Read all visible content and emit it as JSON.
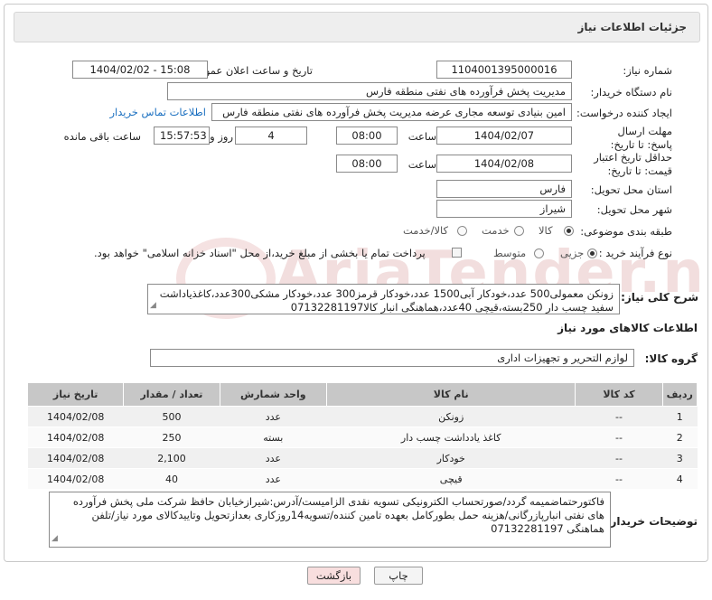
{
  "header": {
    "title": "جزئیات اطلاعات نیاز"
  },
  "fields": {
    "need_number_label": "شماره نیاز:",
    "need_number": "1104001395000016",
    "announce_label": "تاریخ و ساعت اعلان عمومی:",
    "announce_value": "1404/02/02 - 15:08",
    "buyer_org_label": "نام دستگاه خریدار:",
    "buyer_org": "مدیریت پخش فرآورده های نفتی منطقه فارس",
    "requester_label": "ایجاد کننده درخواست:",
    "requester": "امین بنیادی توسعه مجاری عرضه مدیریت پخش فرآورده های نفتی منطقه فارس",
    "contact_link": "اطلاعات تماس خریدار",
    "reply_deadline_label": "مهلت ارسال پاسخ: تا تاریخ:",
    "reply_date": "1404/02/07",
    "time_label": "ساعت",
    "reply_time": "08:00",
    "days_value": "4",
    "days_label": "روز و",
    "remaining_time": "15:57:53",
    "remaining_label": "ساعت باقی مانده",
    "validity_label": "حداقل تاریخ اعتبار قیمت: تا تاریخ:",
    "validity_date": "1404/02/08",
    "validity_time_label": "ساعت",
    "validity_time": "08:00",
    "province_label": "استان محل تحویل:",
    "province": "فارس",
    "city_label": "شهر محل تحویل:",
    "city": "شیراز",
    "category_label": "طبقه بندی موضوعی:",
    "category_options": [
      "کالا",
      "خدمت",
      "کالا/خدمت"
    ],
    "category_selected": "کالا",
    "process_label": "نوع فرآیند خرید :",
    "process_options": [
      "جزیی",
      "متوسط"
    ],
    "process_selected": "جزیی",
    "payment_note": "پرداخت تمام یا بخشی از مبلغ خرید،از محل \"اسناد خزانه اسلامی\" خواهد بود."
  },
  "description": {
    "label": "شرح کلی نیاز:",
    "text": "زونکن معمولی500 عدد،خودکار آبی1500 عدد،خودکار قرمز300 عدد،خودکار مشکی300عدد،کاغذیاداشت سفید چسب دار 250بسته،قیچی 40عدد،هماهنگی انبار کالا07132281197"
  },
  "goods_section": {
    "title": "اطلاعات کالاهای مورد نیاز",
    "group_label": "گروه کالا:",
    "group_value": "لوازم التحریر و تجهیزات اداری"
  },
  "table": {
    "headers": [
      "ردیف",
      "کد کالا",
      "نام کالا",
      "واحد شمارش",
      "تعداد / مقدار",
      "تاریخ نیاز"
    ],
    "rows": [
      [
        "1",
        "--",
        "زونکن",
        "عدد",
        "500",
        "1404/02/08"
      ],
      [
        "2",
        "--",
        "کاغذ یادداشت چسب دار",
        "بسته",
        "250",
        "1404/02/08"
      ],
      [
        "3",
        "--",
        "خودکار",
        "عدد",
        "2,100",
        "1404/02/08"
      ],
      [
        "4",
        "--",
        "قیچی",
        "عدد",
        "40",
        "1404/02/08"
      ]
    ]
  },
  "buyer_notes": {
    "label": "توضیحات خریدار:",
    "text": "فاکتورحتماضمیمه گردد/صورتحساب الکترونیکی تسویه نقدی الزامیست/آدرس:شیرازخیابان حافظ شرکت ملی پخش فرآورده های نفتی انبارپازرگانی/هزینه حمل بطورکامل بعهده تامین کننده/تسویه14روزکاری بعدازتحویل وتاییدکالای مورد نیاز/تلفن هماهنگی 07132281197"
  },
  "buttons": {
    "print": "چاپ",
    "back": "بازگشت"
  },
  "watermark": {
    "text": "AriaTender.net"
  }
}
